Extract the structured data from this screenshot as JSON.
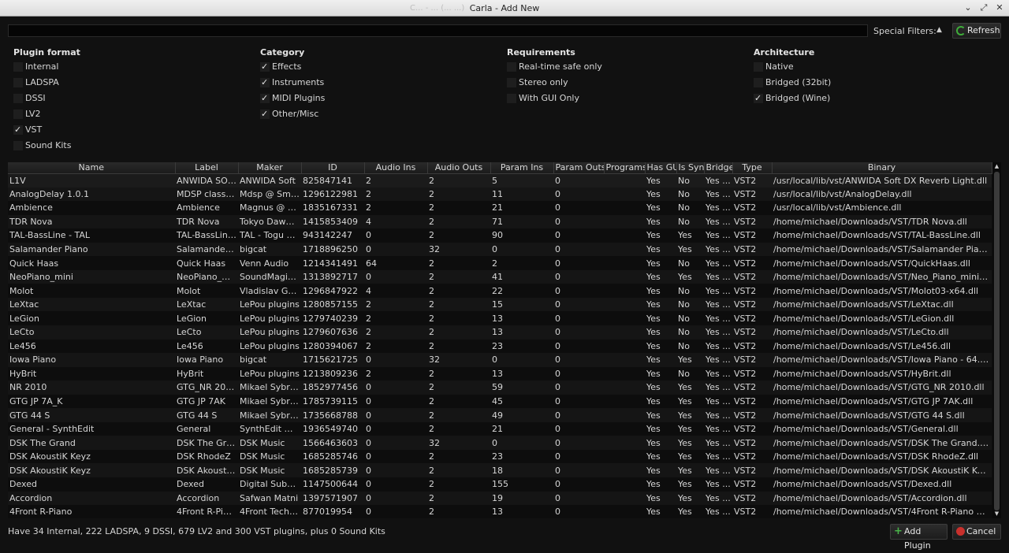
{
  "window": {
    "title": "Carla - Add New",
    "ghost": "C... - ... (... ...)"
  },
  "toolbar": {
    "search_value": "",
    "special_filters_label": "Special Filters:",
    "refresh_label": "Refresh"
  },
  "filters": {
    "plugin_format": {
      "title": "Plugin format",
      "options": [
        {
          "label": "Internal",
          "checked": false
        },
        {
          "label": "LADSPA",
          "checked": false
        },
        {
          "label": "DSSI",
          "checked": false
        },
        {
          "label": "LV2",
          "checked": false
        },
        {
          "label": "VST",
          "checked": true
        },
        {
          "label": "Sound Kits",
          "checked": false
        }
      ]
    },
    "category": {
      "title": "Category",
      "options": [
        {
          "label": "Effects",
          "checked": true
        },
        {
          "label": "Instruments",
          "checked": true
        },
        {
          "label": "MIDI Plugins",
          "checked": true
        },
        {
          "label": "Other/Misc",
          "checked": true
        }
      ]
    },
    "requirements": {
      "title": "Requirements",
      "options": [
        {
          "label": "Real-time safe only",
          "checked": false
        },
        {
          "label": "Stereo only",
          "checked": false
        },
        {
          "label": "With GUI Only",
          "checked": false
        }
      ]
    },
    "architecture": {
      "title": "Architecture",
      "options": [
        {
          "label": "Native",
          "checked": false
        },
        {
          "label": "Bridged (32bit)",
          "checked": false
        },
        {
          "label": "Bridged (Wine)",
          "checked": true
        }
      ]
    }
  },
  "table": {
    "columns": [
      "Name",
      "Label",
      "Maker",
      "ID",
      "Audio Ins",
      "Audio Outs",
      "Param Ins",
      "Param Outs",
      "Programs",
      "Has GUI",
      "Is Synth",
      "Bridged",
      "Type",
      "Binary"
    ],
    "rows": [
      [
        "L1V",
        "ANWIDA SOF...",
        "ANWIDA Soft",
        "825847141",
        "2",
        "2",
        "5",
        "0",
        "",
        "Yes",
        "No",
        "Yes ...",
        "VST2",
        "/usr/local/lib/vst/ANWIDA Soft DX Reverb Light.dll"
      ],
      [
        "AnalogDelay 1.0.1",
        "MDSP classic ...",
        "Mdsp @ Sma...",
        "1296122981",
        "2",
        "2",
        "11",
        "0",
        "",
        "Yes",
        "No",
        "Yes ...",
        "VST2",
        "/usr/local/lib/vst/AnalogDelay.dll"
      ],
      [
        "Ambience",
        "Ambience",
        "Magnus @ S...",
        "1835167331",
        "2",
        "2",
        "21",
        "0",
        "",
        "Yes",
        "No",
        "Yes ...",
        "VST2",
        "/usr/local/lib/vst/Ambience.dll"
      ],
      [
        "TDR Nova",
        "TDR Nova",
        "Tokyo Dawn ...",
        "1415853409",
        "4",
        "2",
        "71",
        "0",
        "",
        "Yes",
        "No",
        "Yes ...",
        "VST2",
        "/home/michael/Downloads/VST/TDR Nova.dll"
      ],
      [
        "TAL-BassLine - TAL",
        "TAL-BassLine...",
        "TAL - Togu A...",
        "943142247",
        "0",
        "2",
        "90",
        "0",
        "",
        "Yes",
        "Yes",
        "Yes ...",
        "VST2",
        "/home/michael/Downloads/VST/TAL-BassLine.dll"
      ],
      [
        "Salamander Piano",
        "Salamander ...",
        "bigcat",
        "1718896250",
        "0",
        "32",
        "0",
        "0",
        "",
        "Yes",
        "Yes",
        "Yes ...",
        "VST2",
        "/home/michael/Downloads/VST/Salamander Piano - 64...."
      ],
      [
        "Quick Haas",
        "Quick Haas",
        "Venn Audio",
        "1214341491",
        "64",
        "2",
        "2",
        "0",
        "",
        "Yes",
        "No",
        "Yes ...",
        "VST2",
        "/home/michael/Downloads/VST/QuickHaas.dll"
      ],
      [
        "NeoPiano_mini",
        "NeoPiano_mini",
        "SoundMagic (...",
        "1313892717",
        "0",
        "2",
        "41",
        "0",
        "",
        "Yes",
        "Yes",
        "Yes ...",
        "VST2",
        "/home/michael/Downloads/VST/Neo_Piano_mini_x64.dll"
      ],
      [
        "Molot",
        "Molot",
        "Vladislav Gon...",
        "1296847922",
        "4",
        "2",
        "22",
        "0",
        "",
        "Yes",
        "No",
        "Yes ...",
        "VST2",
        "/home/michael/Downloads/VST/Molot03-x64.dll"
      ],
      [
        "LeXtac",
        "LeXtac",
        "LePou plugins",
        "1280857155",
        "2",
        "2",
        "15",
        "0",
        "",
        "Yes",
        "No",
        "Yes ...",
        "VST2",
        "/home/michael/Downloads/VST/LeXtac.dll"
      ],
      [
        "LeGion",
        "LeGion",
        "LePou plugins",
        "1279740239",
        "2",
        "2",
        "13",
        "0",
        "",
        "Yes",
        "No",
        "Yes ...",
        "VST2",
        "/home/michael/Downloads/VST/LeGion.dll"
      ],
      [
        "LeCto",
        "LeCto",
        "LePou plugins",
        "1279607636",
        "2",
        "2",
        "13",
        "0",
        "",
        "Yes",
        "No",
        "Yes ...",
        "VST2",
        "/home/michael/Downloads/VST/LeCto.dll"
      ],
      [
        "Le456",
        "Le456",
        "LePou plugins",
        "1280394067",
        "2",
        "2",
        "23",
        "0",
        "",
        "Yes",
        "No",
        "Yes ...",
        "VST2",
        "/home/michael/Downloads/VST/Le456.dll"
      ],
      [
        "Iowa Piano",
        "Iowa Piano",
        "bigcat",
        "1715621725",
        "0",
        "32",
        "0",
        "0",
        "",
        "Yes",
        "Yes",
        "Yes ...",
        "VST2",
        "/home/michael/Downloads/VST/Iowa Piano - 64.dll"
      ],
      [
        "HyBrit",
        "HyBrit",
        "LePou plugins",
        "1213809236",
        "2",
        "2",
        "13",
        "0",
        "",
        "Yes",
        "No",
        "Yes ...",
        "VST2",
        "/home/michael/Downloads/VST/HyBrit.dll"
      ],
      [
        "NR 2010",
        "GTG_NR 2010",
        "Mikael Sybra...",
        "1852977456",
        "0",
        "2",
        "59",
        "0",
        "",
        "Yes",
        "Yes",
        "Yes ...",
        "VST2",
        "/home/michael/Downloads/VST/GTG_NR 2010.dll"
      ],
      [
        "GTG JP 7A_K",
        "GTG JP 7AK",
        "Mikael Sybra...",
        "1785739115",
        "0",
        "2",
        "45",
        "0",
        "",
        "Yes",
        "Yes",
        "Yes ...",
        "VST2",
        "/home/michael/Downloads/VST/GTG JP 7AK.dll"
      ],
      [
        "GTG 44 S",
        "GTG 44 S",
        "Mikael Sybra...",
        "1735668788",
        "0",
        "2",
        "49",
        "0",
        "",
        "Yes",
        "Yes",
        "Yes ...",
        "VST2",
        "/home/michael/Downloads/VST/GTG 44 S.dll"
      ],
      [
        "General - SynthEdit",
        "General",
        "SynthEdit ww...",
        "1936549740",
        "0",
        "2",
        "21",
        "0",
        "",
        "Yes",
        "Yes",
        "Yes ...",
        "VST2",
        "/home/michael/Downloads/VST/General.dll"
      ],
      [
        "DSK The Grand",
        "DSK The Grand",
        "DSK Music",
        "1566463603",
        "0",
        "32",
        "0",
        "0",
        "",
        "Yes",
        "Yes",
        "Yes ...",
        "VST2",
        "/home/michael/Downloads/VST/DSK The Grand.dll"
      ],
      [
        "DSK AkoustiK Keyz",
        "DSK RhodeZ",
        "DSK Music",
        "1685285746",
        "0",
        "2",
        "23",
        "0",
        "",
        "Yes",
        "Yes",
        "Yes ...",
        "VST2",
        "/home/michael/Downloads/VST/DSK RhodeZ.dll"
      ],
      [
        "DSK AkoustiK Keyz",
        "DSK AkoustiK...",
        "DSK Music",
        "1685285739",
        "0",
        "2",
        "18",
        "0",
        "",
        "Yes",
        "Yes",
        "Yes ...",
        "VST2",
        "/home/michael/Downloads/VST/DSK AkoustiK KeyZ.dll"
      ],
      [
        "Dexed",
        "Dexed",
        "Digital Subur...",
        "1147500644",
        "0",
        "2",
        "155",
        "0",
        "",
        "Yes",
        "Yes",
        "Yes ...",
        "VST2",
        "/home/michael/Downloads/VST/Dexed.dll"
      ],
      [
        "Accordion",
        "Accordion",
        "Safwan Matni",
        "1397571907",
        "0",
        "2",
        "19",
        "0",
        "",
        "Yes",
        "Yes",
        "Yes ...",
        "VST2",
        "/home/michael/Downloads/VST/Accordion.dll"
      ],
      [
        "4Front R-Piano",
        "4Front R-Piano",
        "4Front Techn...",
        "877019954",
        "0",
        "2",
        "13",
        "0",
        "",
        "Yes",
        "Yes",
        "Yes ...",
        "VST2",
        "/home/michael/Downloads/VST/4Front R-Piano x64.dll"
      ]
    ]
  },
  "status": {
    "text": "Have 34 Internal, 222 LADSPA, 9 DSSI, 679 LV2 and 300 VST plugins, plus 0 Sound Kits"
  },
  "buttons": {
    "add_plugin": "Add Plugin",
    "cancel": "Cancel"
  }
}
